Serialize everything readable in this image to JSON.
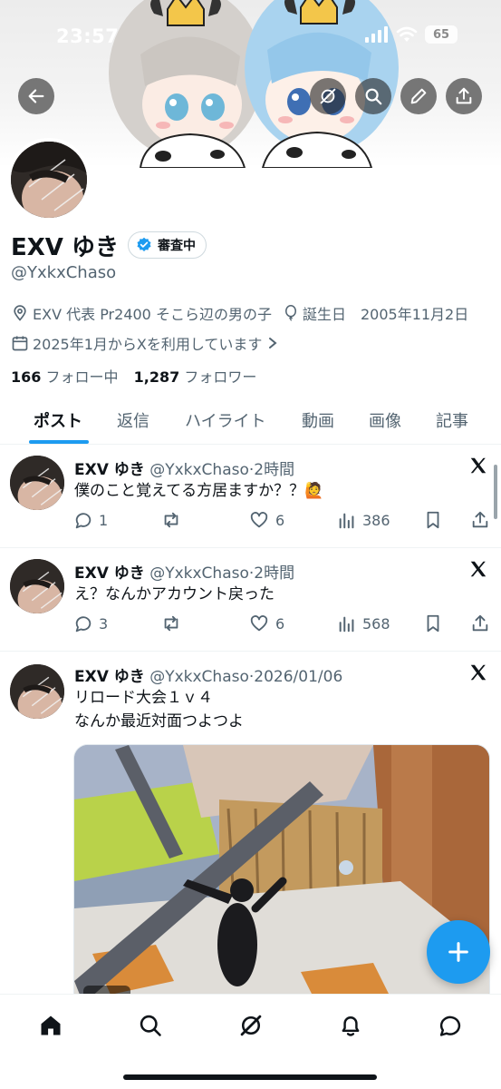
{
  "status_bar": {
    "time": "23:57",
    "battery": "65"
  },
  "profile": {
    "display_name": "EXV ゆき",
    "verify_badge": "審査中",
    "handle": "@YxkxChaso",
    "bio_location": "EXV 代表 Pr2400 そこら辺の男の子",
    "birthday_label": "誕生日",
    "birthday": "2005年11月2日",
    "joined": "2025年1月からXを利用しています",
    "following_count": "166",
    "following_label": "フォロー中",
    "followers_count": "1,287",
    "followers_label": "フォロワー"
  },
  "tabs": [
    "ポスト",
    "返信",
    "ハイライト",
    "動画",
    "画像",
    "記事"
  ],
  "posts": [
    {
      "name": "EXV ゆき",
      "handle": "@YxkxChaso",
      "time": "2時間",
      "lines": [
        "僕のこと覚えてる方居ますか？？🙋"
      ],
      "replies": "1",
      "likes": "6",
      "views": "386"
    },
    {
      "name": "EXV ゆき",
      "handle": "@YxkxChaso",
      "time": "2時間",
      "lines": [
        "え？なんかアカウント戻った"
      ],
      "replies": "3",
      "likes": "6",
      "views": "568"
    },
    {
      "name": "EXV ゆき",
      "handle": "@YxkxChaso",
      "time": "2026/01/06",
      "lines": [
        "リロード大会１ｖ４",
        "なんか最近対面つよつよ"
      ],
      "media": "video-game-screenshot"
    }
  ],
  "colors": {
    "accent": "#1d9bf0",
    "text": "#0f1419",
    "muted": "#536471",
    "divider": "#eff3f4"
  },
  "icons": [
    "back-arrow-icon",
    "grok-icon",
    "search-icon",
    "edit-icon",
    "share-icon",
    "location-icon",
    "balloon-icon",
    "calendar-icon",
    "verified-icon",
    "reply-icon",
    "repost-icon",
    "like-icon",
    "views-icon",
    "bookmark-icon",
    "x-logo-icon",
    "plus-icon",
    "home-icon",
    "notifications-icon",
    "messages-icon"
  ]
}
